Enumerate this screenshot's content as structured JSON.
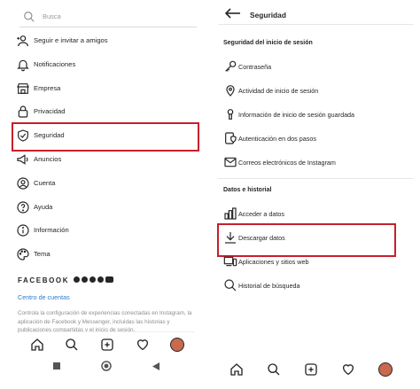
{
  "left": {
    "search": {
      "placeholder": "Busca"
    },
    "menu": [
      {
        "label": "Seguir e invitar a amigos",
        "icon": "add-person-icon"
      },
      {
        "label": "Notificaciones",
        "icon": "bell-icon"
      },
      {
        "label": "Empresa",
        "icon": "shop-icon"
      },
      {
        "label": "Privacidad",
        "icon": "lock-icon"
      },
      {
        "label": "Seguridad",
        "icon": "shield-icon"
      },
      {
        "label": "Anuncios",
        "icon": "megaphone-icon"
      },
      {
        "label": "Cuenta",
        "icon": "person-circle-icon"
      },
      {
        "label": "Ayuda",
        "icon": "help-icon"
      },
      {
        "label": "Información",
        "icon": "info-icon"
      },
      {
        "label": "Tema",
        "icon": "palette-icon"
      }
    ],
    "facebook": {
      "wordmark": "FACEBOOK",
      "centro": "Centro de cuentas",
      "description": "Controla la configuración de experiencias conectadas en Instagram, la aplicación de Facebook y Messenger, incluidas las historias y publicaciones compartidas y el inicio de sesión."
    }
  },
  "right": {
    "title": "Seguridad",
    "section1": "Seguridad del inicio de sesión",
    "items1": [
      {
        "label": "Contraseña",
        "icon": "key-icon"
      },
      {
        "label": "Actividad de inicio de sesión",
        "icon": "location-pin-icon"
      },
      {
        "label": "Información de inicio de sesión guardada",
        "icon": "keyhole-icon"
      },
      {
        "label": "Autenticación en dos pasos",
        "icon": "phone-shield-icon"
      },
      {
        "label": "Correos electrónicos de Instagram",
        "icon": "envelope-icon"
      }
    ],
    "section2": "Datos e historial",
    "items2": [
      {
        "label": "Acceder a datos",
        "icon": "bar-chart-icon"
      },
      {
        "label": "Descargar datos",
        "icon": "download-icon"
      },
      {
        "label": "Aplicaciones y sitios web",
        "icon": "devices-icon"
      },
      {
        "label": "Historial de búsqueda",
        "icon": "search-icon"
      }
    ]
  },
  "colors": {
    "highlight": "#c61f2b",
    "link": "#2a7bd3",
    "text": "#262626"
  }
}
